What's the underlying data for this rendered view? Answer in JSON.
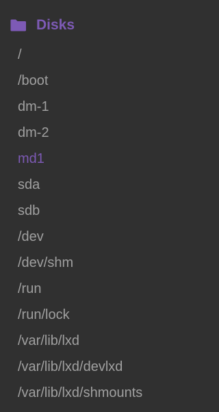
{
  "colors": {
    "background": "#303030",
    "text": "#a0a0a0",
    "accent": "#7d5ab5"
  },
  "section": {
    "title": "Disks",
    "icon": "folder-icon"
  },
  "items": [
    {
      "label": "/",
      "selected": false
    },
    {
      "label": "/boot",
      "selected": false
    },
    {
      "label": "dm-1",
      "selected": false
    },
    {
      "label": "dm-2",
      "selected": false
    },
    {
      "label": "md1",
      "selected": true
    },
    {
      "label": "sda",
      "selected": false
    },
    {
      "label": "sdb",
      "selected": false
    },
    {
      "label": "/dev",
      "selected": false
    },
    {
      "label": "/dev/shm",
      "selected": false
    },
    {
      "label": "/run",
      "selected": false
    },
    {
      "label": "/run/lock",
      "selected": false
    },
    {
      "label": "/var/lib/lxd",
      "selected": false
    },
    {
      "label": "/var/lib/lxd/devlxd",
      "selected": false
    },
    {
      "label": "/var/lib/lxd/shmounts",
      "selected": false
    }
  ]
}
